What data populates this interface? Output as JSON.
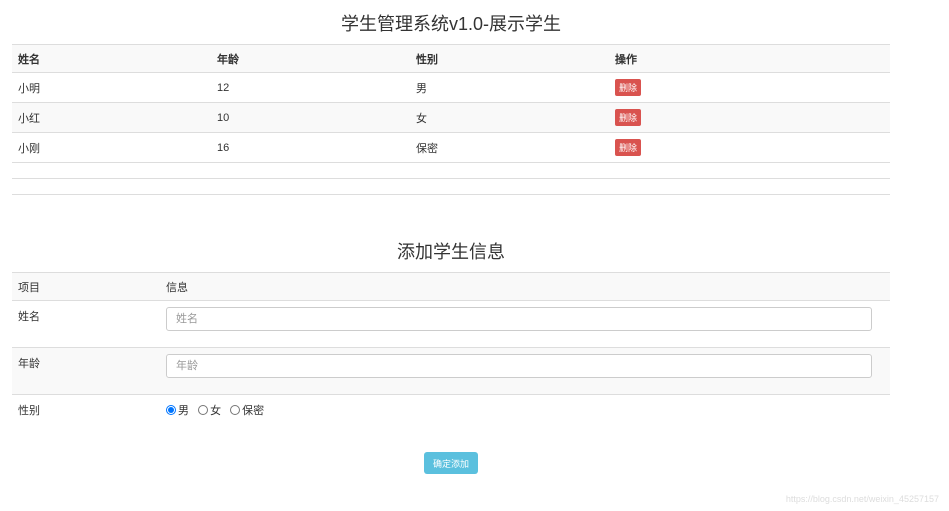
{
  "list": {
    "title": "学生管理系统v1.0-展示学生",
    "headers": [
      "姓名",
      "年龄",
      "性别",
      "操作"
    ],
    "rows": [
      {
        "name": "小明",
        "age": "12",
        "gender": "男",
        "action": "删除"
      },
      {
        "name": "小红",
        "age": "10",
        "gender": "女",
        "action": "删除"
      },
      {
        "name": "小刚",
        "age": "16",
        "gender": "保密",
        "action": "删除"
      }
    ]
  },
  "form": {
    "title": "添加学生信息",
    "headers": [
      "项目",
      "信息"
    ],
    "name_label": "姓名",
    "name_placeholder": "姓名",
    "age_label": "年龄",
    "age_placeholder": "年龄",
    "gender_label": "性别",
    "gender_options": [
      "男",
      "女",
      "保密"
    ],
    "gender_selected": "男",
    "submit": "确定添加"
  },
  "watermark": "https://blog.csdn.net/weixin_45257157"
}
